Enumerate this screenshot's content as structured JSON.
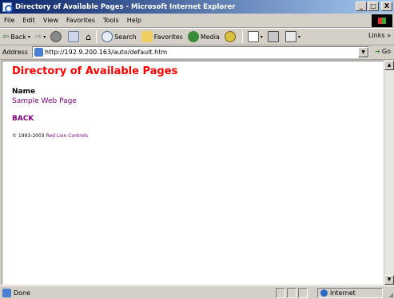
{
  "window": {
    "title": "Directory of Available Pages - Microsoft Internet Explorer",
    "minimize": "_",
    "maximize": "□",
    "close": "X"
  },
  "menu": {
    "file": "File",
    "edit": "Edit",
    "view": "View",
    "favorites": "Favorites",
    "tools": "Tools",
    "help": "Help"
  },
  "toolbar": {
    "back": "Back",
    "search": "Search",
    "favorites": "Favorites",
    "media": "Media",
    "links": "Links"
  },
  "address": {
    "label": "Address",
    "url": "http://192.9.200.163/auto/default.htm",
    "go": "Go"
  },
  "page": {
    "title": "Directory of Available Pages",
    "name_header": "Name",
    "links": [
      "Sample Web Page"
    ],
    "back": "BACK",
    "copyright_prefix": "© 1993-2003",
    "copyright_company": "Red Lion Controls"
  },
  "status": {
    "text": "Done",
    "zone": "Internet"
  },
  "colors": {
    "title_red": "#ff0000",
    "visited_link": "#800080",
    "titlebar_start": "#0a246a",
    "titlebar_end": "#a6caf0"
  }
}
